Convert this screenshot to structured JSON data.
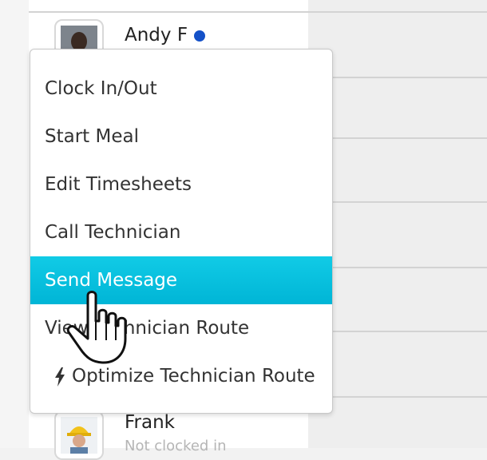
{
  "technicians": [
    {
      "name": "Andy F",
      "online": true,
      "status_color": "#1451c8"
    },
    {
      "name": "Frank",
      "status": "Not clocked in"
    }
  ],
  "context_menu": {
    "items": [
      {
        "label": "Clock In/Out"
      },
      {
        "label": "Start Meal"
      },
      {
        "label": "Edit Timesheets"
      },
      {
        "label": "Call Technician"
      },
      {
        "label": "Send Message",
        "highlighted": true
      },
      {
        "label": "View Technician Route"
      },
      {
        "label": "Optimize Technician Route",
        "icon": "bolt-icon"
      }
    ],
    "highlight_color": "#00bfdf"
  }
}
